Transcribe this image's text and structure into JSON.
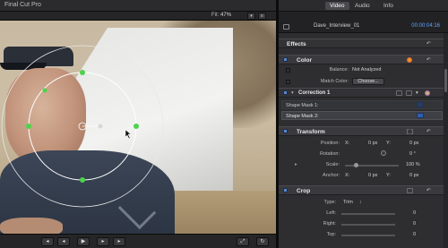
{
  "app": {
    "title": "Final Cut Pro"
  },
  "viewer": {
    "fit_label": "Fit:",
    "zoom": "47%"
  },
  "inspector": {
    "tabs": [
      {
        "label": "Video",
        "active": true
      },
      {
        "label": "Audio",
        "active": false
      },
      {
        "label": "Info",
        "active": false
      }
    ],
    "clip_name": "Dave_Interview_01",
    "timecode": "00:00:04:16",
    "effects": {
      "header": "Effects",
      "color": {
        "title": "Color",
        "balance_label": "Balance:",
        "balance_value": "Not Analyzed",
        "match_label": "Match Color:",
        "match_button": "Choose...",
        "correction_title": "Correction 1",
        "shape_mask_1": "Shape Mask 1:",
        "shape_mask_2": "Shape Mask 2:"
      }
    },
    "transform": {
      "title": "Transform",
      "position_label": "Position:",
      "position_x_label": "X:",
      "position_x": "0 px",
      "position_y_label": "Y:",
      "position_y": "0 px",
      "rotation_label": "Rotation:",
      "rotation_value": "0 °",
      "scale_label": "Scale:",
      "scale_value": "100 %",
      "anchor_label": "Anchor:",
      "anchor_x_label": "X:",
      "anchor_x": "0 px",
      "anchor_y_label": "Y:",
      "anchor_y": "0 px"
    },
    "crop": {
      "title": "Crop",
      "type_label": "Type:",
      "type_value": "Trim",
      "left_label": "Left:",
      "left_value": "0",
      "right_label": "Right:",
      "right_value": "0",
      "top_label": "Top:",
      "top_value": "0"
    }
  },
  "colors": {
    "accent_blue": "#5fa3ff",
    "mask_green": "#4dd24d"
  }
}
